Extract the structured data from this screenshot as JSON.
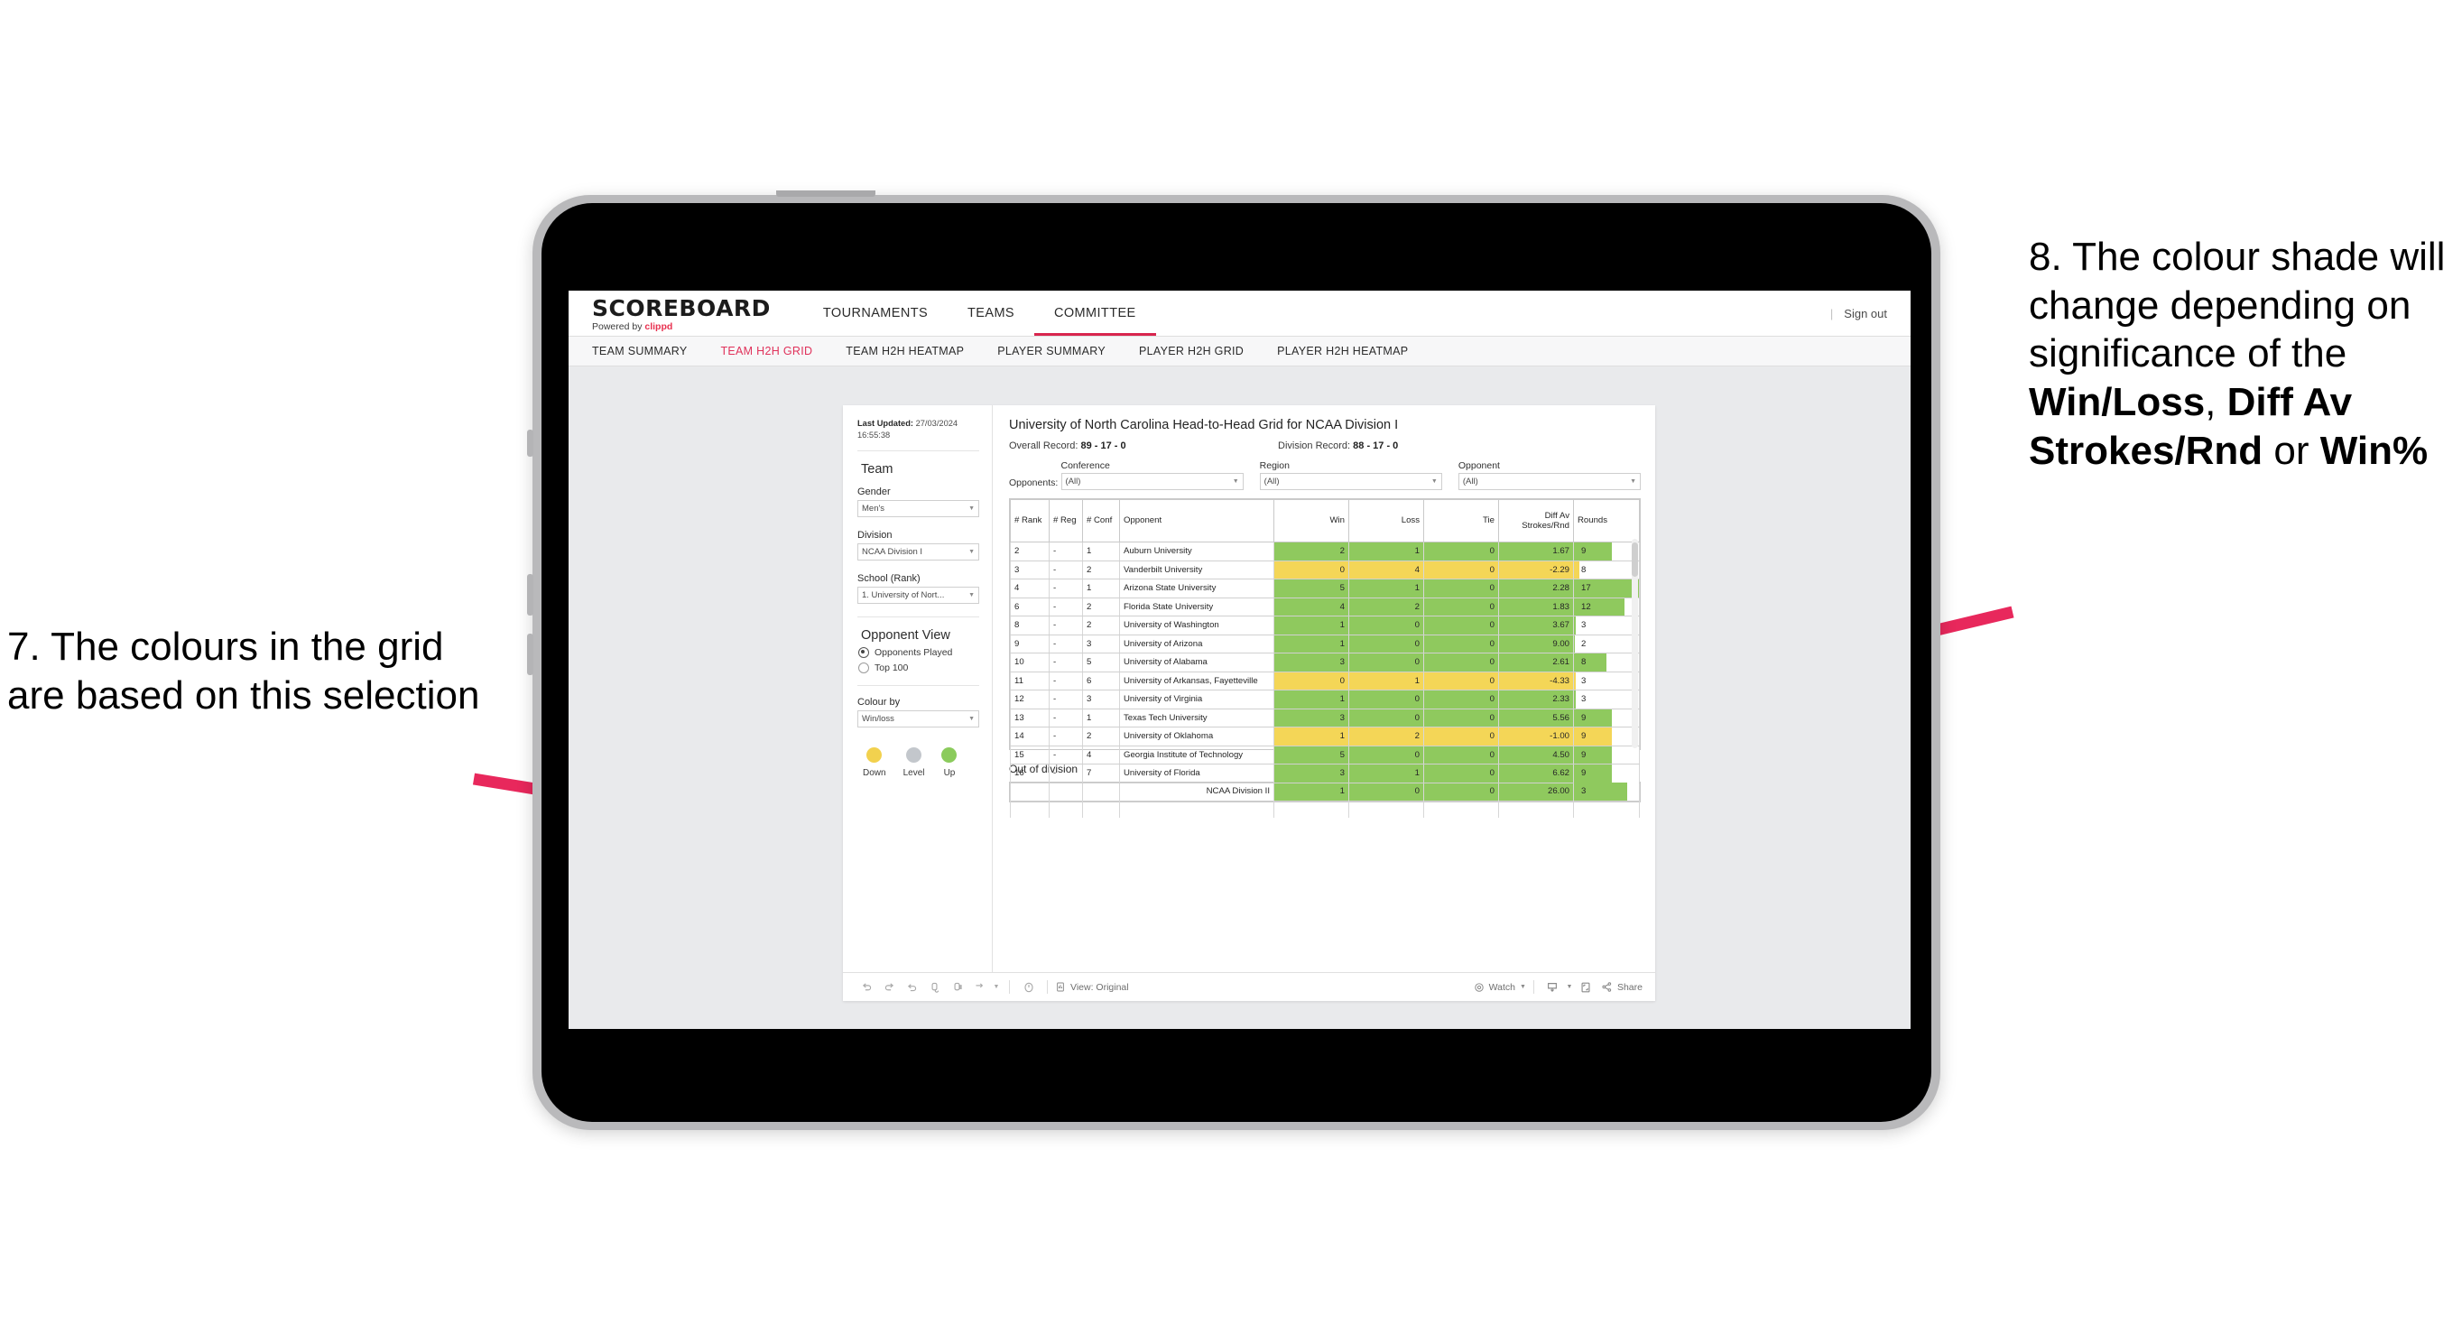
{
  "annotations": {
    "left": {
      "text": "7. The colours in the grid are based on this selection",
      "arrow_color": "#e8285c"
    },
    "right": {
      "part1": "8. The colour shade will change depending on significance of the ",
      "bold1": "Win/Loss",
      "mid1": ", ",
      "bold2": "Diff Av Strokes/Rnd",
      "mid2": " or ",
      "bold3": "Win%",
      "arrow_color": "#e8285c"
    }
  },
  "app": {
    "logo_main": "SCOREBOARD",
    "logo_sub_prefix": "Powered by ",
    "logo_brand": "clippd",
    "sign_out": "Sign out",
    "top_nav": [
      {
        "label": "TOURNAMENTS",
        "active": false
      },
      {
        "label": "TEAMS",
        "active": false
      },
      {
        "label": "COMMITTEE",
        "active": true
      }
    ],
    "sub_nav": [
      {
        "label": "TEAM SUMMARY",
        "active": false
      },
      {
        "label": "TEAM H2H GRID",
        "active": true
      },
      {
        "label": "TEAM H2H HEATMAP",
        "active": false
      },
      {
        "label": "PLAYER SUMMARY",
        "active": false
      },
      {
        "label": "PLAYER H2H GRID",
        "active": false
      },
      {
        "label": "PLAYER H2H HEATMAP",
        "active": false
      }
    ]
  },
  "sidebar": {
    "last_updated_label": "Last Updated:",
    "last_updated_value": "27/03/2024 16:55:38",
    "team_heading": "Team",
    "gender_label": "Gender",
    "gender_value": "Men's",
    "division_label": "Division",
    "division_value": "NCAA Division I",
    "school_label": "School (Rank)",
    "school_value": "1. University of Nort...",
    "opponent_view_heading": "Opponent View",
    "radio_opponents_played": "Opponents Played",
    "radio_top_100": "Top 100",
    "colour_by_label": "Colour by",
    "colour_by_value": "Win/loss",
    "legend": [
      {
        "label": "Down",
        "color": "#f2d14e"
      },
      {
        "label": "Level",
        "color": "#c3c7cc"
      },
      {
        "label": "Up",
        "color": "#8bcb5c"
      }
    ]
  },
  "main": {
    "title": "University of North Carolina Head-to-Head Grid for NCAA Division I",
    "overall_record_label": "Overall Record:",
    "overall_record_value": "89 - 17 - 0",
    "division_record_label": "Division Record:",
    "division_record_value": "88 - 17 - 0",
    "opponents_label": "Opponents:",
    "filters": [
      {
        "label": "Conference",
        "value": "(All)"
      },
      {
        "label": "Region",
        "value": "(All)"
      },
      {
        "label": "Opponent",
        "value": "(All)"
      }
    ],
    "columns": [
      "# Rank",
      "# Reg",
      "# Conf",
      "Opponent",
      "Win",
      "Loss",
      "Tie",
      "Diff Av Strokes/Rnd",
      "Rounds"
    ],
    "rows": [
      {
        "rank": "2",
        "reg": "-",
        "conf": "1",
        "opponent": "Auburn University",
        "win": "2",
        "loss": "1",
        "tie": "0",
        "diff": "1.67",
        "rounds": "9",
        "color": "green",
        "bar_pct": 58
      },
      {
        "rank": "3",
        "reg": "-",
        "conf": "2",
        "opponent": "Vanderbilt University",
        "win": "0",
        "loss": "4",
        "tie": "0",
        "diff": "-2.29",
        "rounds": "8",
        "color": "yellow",
        "bar_pct": 8
      },
      {
        "rank": "4",
        "reg": "-",
        "conf": "1",
        "opponent": "Arizona State University",
        "win": "5",
        "loss": "1",
        "tie": "0",
        "diff": "2.28",
        "rounds": "17",
        "color": "green",
        "bar_pct": 100
      },
      {
        "rank": "6",
        "reg": "-",
        "conf": "2",
        "opponent": "Florida State University",
        "win": "4",
        "loss": "2",
        "tie": "0",
        "diff": "1.83",
        "rounds": "12",
        "color": "green",
        "bar_pct": 78
      },
      {
        "rank": "8",
        "reg": "-",
        "conf": "2",
        "opponent": "University of Washington",
        "win": "1",
        "loss": "0",
        "tie": "0",
        "diff": "3.67",
        "rounds": "3",
        "color": "green",
        "bar_pct": 3
      },
      {
        "rank": "9",
        "reg": "-",
        "conf": "3",
        "opponent": "University of Arizona",
        "win": "1",
        "loss": "0",
        "tie": "0",
        "diff": "9.00",
        "rounds": "2",
        "color": "green",
        "bar_pct": 2
      },
      {
        "rank": "10",
        "reg": "-",
        "conf": "5",
        "opponent": "University of Alabama",
        "win": "3",
        "loss": "0",
        "tie": "0",
        "diff": "2.61",
        "rounds": "8",
        "color": "green",
        "bar_pct": 50
      },
      {
        "rank": "11",
        "reg": "-",
        "conf": "6",
        "opponent": "University of Arkansas, Fayetteville",
        "win": "0",
        "loss": "1",
        "tie": "0",
        "diff": "-4.33",
        "rounds": "3",
        "color": "yellow",
        "bar_pct": 3
      },
      {
        "rank": "12",
        "reg": "-",
        "conf": "3",
        "opponent": "University of Virginia",
        "win": "1",
        "loss": "0",
        "tie": "0",
        "diff": "2.33",
        "rounds": "3",
        "color": "green",
        "bar_pct": 3
      },
      {
        "rank": "13",
        "reg": "-",
        "conf": "1",
        "opponent": "Texas Tech University",
        "win": "3",
        "loss": "0",
        "tie": "0",
        "diff": "5.56",
        "rounds": "9",
        "color": "green",
        "bar_pct": 58
      },
      {
        "rank": "14",
        "reg": "-",
        "conf": "2",
        "opponent": "University of Oklahoma",
        "win": "1",
        "loss": "2",
        "tie": "0",
        "diff": "-1.00",
        "rounds": "9",
        "color": "yellow",
        "bar_pct": 58
      },
      {
        "rank": "15",
        "reg": "-",
        "conf": "4",
        "opponent": "Georgia Institute of Technology",
        "win": "5",
        "loss": "0",
        "tie": "0",
        "diff": "4.50",
        "rounds": "9",
        "color": "green",
        "bar_pct": 58
      },
      {
        "rank": "16",
        "reg": "-",
        "conf": "7",
        "opponent": "University of Florida",
        "win": "3",
        "loss": "1",
        "tie": "0",
        "diff": "6.62",
        "rounds": "9",
        "color": "green",
        "bar_pct": 58
      }
    ],
    "out_of_division_title": "Out of division",
    "out_of_division_row": {
      "label": "NCAA Division II",
      "win": "1",
      "loss": "0",
      "tie": "0",
      "diff": "26.00",
      "rounds": "3",
      "color": "green",
      "bar_pct": 82
    }
  },
  "toolbar": {
    "undo": "undo-icon",
    "redo": "redo-icon",
    "revert": "revert-icon",
    "refresh": "refresh-icon",
    "pause": "pause-icon",
    "view_label": "View: Original",
    "watch_label": "Watch",
    "share_label": "Share"
  },
  "chart_data": {
    "type": "table",
    "title": "University of North Carolina Head-to-Head Grid for NCAA Division I",
    "colour_by": "Win/loss",
    "legend": {
      "Down": "#f2d14e",
      "Level": "#c3c7cc",
      "Up": "#8bcb5c"
    },
    "columns": [
      "# Rank",
      "# Reg",
      "# Conf",
      "Opponent",
      "Win",
      "Loss",
      "Tie",
      "Diff Av Strokes/Rnd",
      "Rounds"
    ],
    "values": [
      [
        "2",
        "-",
        "1",
        "Auburn University",
        2,
        1,
        0,
        1.67,
        9
      ],
      [
        "3",
        "-",
        "2",
        "Vanderbilt University",
        0,
        4,
        0,
        -2.29,
        8
      ],
      [
        "4",
        "-",
        "1",
        "Arizona State University",
        5,
        1,
        0,
        2.28,
        17
      ],
      [
        "6",
        "-",
        "2",
        "Florida State University",
        4,
        2,
        0,
        1.83,
        12
      ],
      [
        "8",
        "-",
        "2",
        "University of Washington",
        1,
        0,
        0,
        3.67,
        3
      ],
      [
        "9",
        "-",
        "3",
        "University of Arizona",
        1,
        0,
        0,
        9.0,
        2
      ],
      [
        "10",
        "-",
        "5",
        "University of Alabama",
        3,
        0,
        0,
        2.61,
        8
      ],
      [
        "11",
        "-",
        "6",
        "University of Arkansas, Fayetteville",
        0,
        1,
        0,
        -4.33,
        3
      ],
      [
        "12",
        "-",
        "3",
        "University of Virginia",
        1,
        0,
        0,
        2.33,
        3
      ],
      [
        "13",
        "-",
        "1",
        "Texas Tech University",
        3,
        0,
        0,
        5.56,
        9
      ],
      [
        "14",
        "-",
        "2",
        "University of Oklahoma",
        1,
        2,
        0,
        -1.0,
        9
      ],
      [
        "15",
        "-",
        "4",
        "Georgia Institute of Technology",
        5,
        0,
        0,
        4.5,
        9
      ],
      [
        "16",
        "-",
        "7",
        "University of Florida",
        3,
        1,
        0,
        6.62,
        9
      ]
    ],
    "out_of_division": [
      [
        "NCAA Division II",
        1,
        0,
        0,
        26.0,
        3
      ]
    ],
    "overall_record": "89 - 17 - 0",
    "division_record": "88 - 17 - 0"
  }
}
